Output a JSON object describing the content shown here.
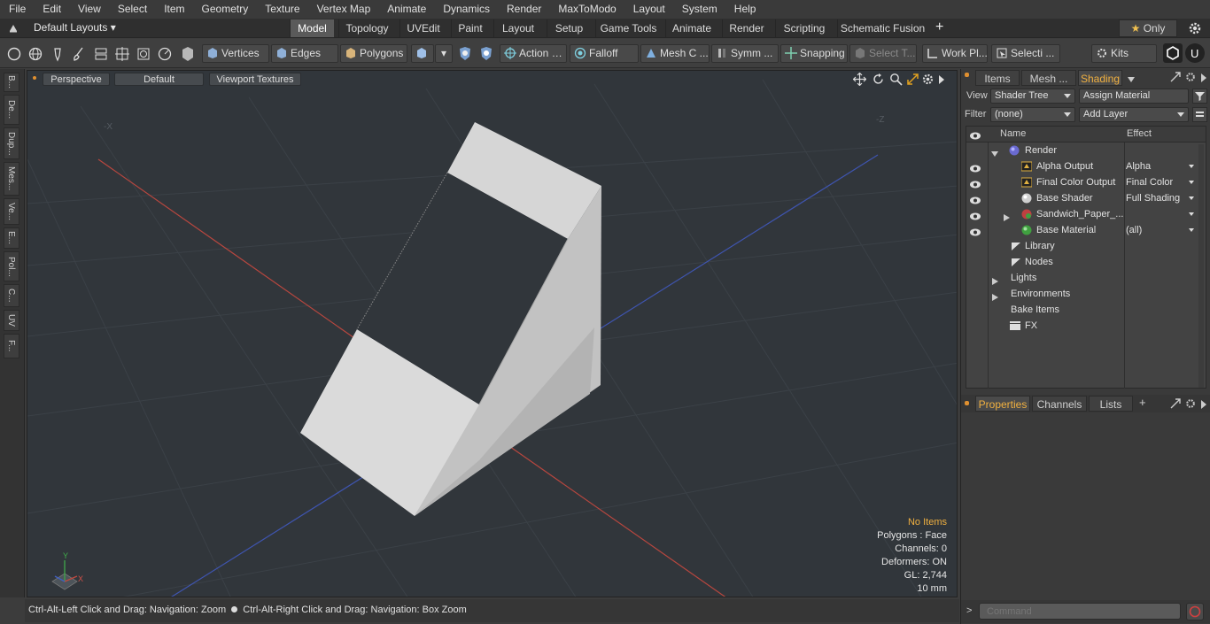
{
  "menu": [
    "File",
    "Edit",
    "View",
    "Select",
    "Item",
    "Geometry",
    "Texture",
    "Vertex Map",
    "Animate",
    "Dynamics",
    "Render",
    "MaxToModo",
    "Layout",
    "System",
    "Help"
  ],
  "layout_bar": {
    "preset": "Default Layouts",
    "tabs": [
      "Model",
      "Topology",
      "UVEdit",
      "Paint",
      "Layout",
      "Setup",
      "Game Tools",
      "Animate",
      "Render",
      "Scripting",
      "Schematic Fusion"
    ],
    "active_tab": "Model",
    "add": "+",
    "only_label": "Only"
  },
  "toolbar": {
    "vertices": "Vertices",
    "edges": "Edges",
    "polygons": "Polygons",
    "action": "Action",
    "falloff": "Falloff",
    "mesh_c": "Mesh C ...",
    "symm": "Symm ...",
    "snapping": "Snapping",
    "select_t": "Select T...",
    "work_pl": "Work Pl...",
    "selecti": "Selecti ...",
    "kits": "Kits"
  },
  "left_tabs": [
    "B...",
    "De...",
    "Dup...",
    "Mes...",
    "Ve...",
    "E...",
    "Pol...",
    "C...",
    "UV",
    "F..."
  ],
  "viewport": {
    "perspective": "Perspective",
    "default": "Default",
    "textures": "Viewport Textures",
    "axis_minus_x": "-X",
    "axis_minus_z": "-Z",
    "hud": {
      "items": "No Items",
      "polygons": "Polygons : Face",
      "channels": "Channels: 0",
      "deformers": "Deformers: ON",
      "gl": "GL: 2,744",
      "unit": "10 mm"
    },
    "gizmo": {
      "y": "Y",
      "x": "X"
    }
  },
  "status": {
    "left": "Ctrl-Alt-Left Click and Drag: Navigation: Zoom",
    "right": "Ctrl-Alt-Right Click and Drag: Navigation: Box Zoom"
  },
  "right_panel": {
    "tabs": [
      "Items",
      "Mesh ...",
      "Shading"
    ],
    "active_tab": "Shading",
    "view_label": "View",
    "view_value": "Shader Tree",
    "assign_material": "Assign Material",
    "filter_label": "Filter",
    "filter_value": "(none)",
    "add_layer": "Add Layer",
    "col_name": "Name",
    "col_effect": "Effect",
    "tree": [
      {
        "name": "Render",
        "effect": ""
      },
      {
        "name": "Alpha Output",
        "effect": "Alpha"
      },
      {
        "name": "Final Color Output",
        "effect": "Final Color"
      },
      {
        "name": "Base Shader",
        "effect": "Full Shading"
      },
      {
        "name": "Sandwich_Paper_...",
        "effect": ""
      },
      {
        "name": "Base Material",
        "effect": "(all)"
      },
      {
        "name": "Library",
        "effect": ""
      },
      {
        "name": "Nodes",
        "effect": ""
      },
      {
        "name": "Lights",
        "effect": ""
      },
      {
        "name": "Environments",
        "effect": ""
      },
      {
        "name": "Bake Items",
        "effect": ""
      },
      {
        "name": "FX",
        "effect": ""
      }
    ],
    "bottom_tabs": [
      "Properties",
      "Channels",
      "Lists"
    ],
    "bottom_active": "Properties",
    "bottom_add": "+",
    "command_placeholder": "Command"
  },
  "colors": {
    "accent": "#f0b040",
    "viewport_bg": "#31363b",
    "x_axis": "#b8473f",
    "z_axis": "#3f55b0"
  }
}
